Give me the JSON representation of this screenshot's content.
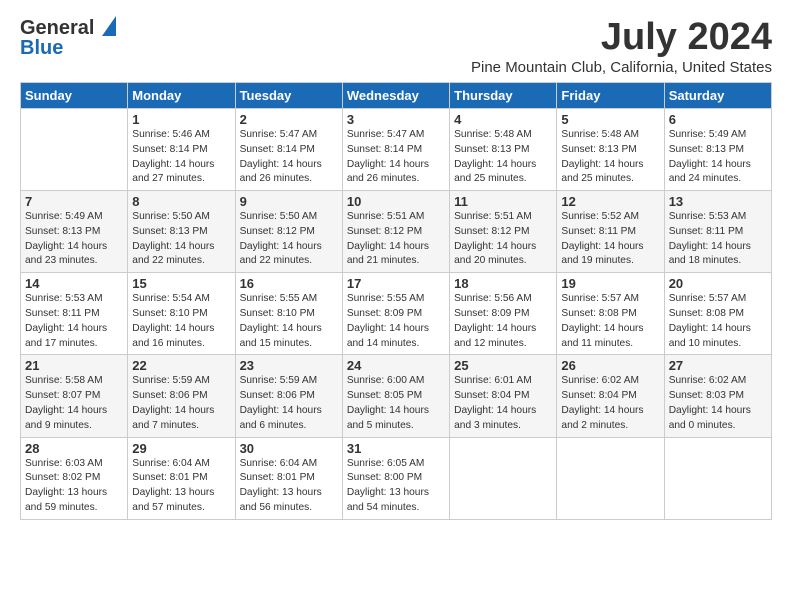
{
  "logo": {
    "general": "General",
    "blue": "Blue"
  },
  "title": "July 2024",
  "subtitle": "Pine Mountain Club, California, United States",
  "days_header": [
    "Sunday",
    "Monday",
    "Tuesday",
    "Wednesday",
    "Thursday",
    "Friday",
    "Saturday"
  ],
  "weeks": [
    [
      {
        "num": "",
        "info": ""
      },
      {
        "num": "1",
        "info": "Sunrise: 5:46 AM\nSunset: 8:14 PM\nDaylight: 14 hours\nand 27 minutes."
      },
      {
        "num": "2",
        "info": "Sunrise: 5:47 AM\nSunset: 8:14 PM\nDaylight: 14 hours\nand 26 minutes."
      },
      {
        "num": "3",
        "info": "Sunrise: 5:47 AM\nSunset: 8:14 PM\nDaylight: 14 hours\nand 26 minutes."
      },
      {
        "num": "4",
        "info": "Sunrise: 5:48 AM\nSunset: 8:13 PM\nDaylight: 14 hours\nand 25 minutes."
      },
      {
        "num": "5",
        "info": "Sunrise: 5:48 AM\nSunset: 8:13 PM\nDaylight: 14 hours\nand 25 minutes."
      },
      {
        "num": "6",
        "info": "Sunrise: 5:49 AM\nSunset: 8:13 PM\nDaylight: 14 hours\nand 24 minutes."
      }
    ],
    [
      {
        "num": "7",
        "info": "Sunrise: 5:49 AM\nSunset: 8:13 PM\nDaylight: 14 hours\nand 23 minutes."
      },
      {
        "num": "8",
        "info": "Sunrise: 5:50 AM\nSunset: 8:13 PM\nDaylight: 14 hours\nand 22 minutes."
      },
      {
        "num": "9",
        "info": "Sunrise: 5:50 AM\nSunset: 8:12 PM\nDaylight: 14 hours\nand 22 minutes."
      },
      {
        "num": "10",
        "info": "Sunrise: 5:51 AM\nSunset: 8:12 PM\nDaylight: 14 hours\nand 21 minutes."
      },
      {
        "num": "11",
        "info": "Sunrise: 5:51 AM\nSunset: 8:12 PM\nDaylight: 14 hours\nand 20 minutes."
      },
      {
        "num": "12",
        "info": "Sunrise: 5:52 AM\nSunset: 8:11 PM\nDaylight: 14 hours\nand 19 minutes."
      },
      {
        "num": "13",
        "info": "Sunrise: 5:53 AM\nSunset: 8:11 PM\nDaylight: 14 hours\nand 18 minutes."
      }
    ],
    [
      {
        "num": "14",
        "info": "Sunrise: 5:53 AM\nSunset: 8:11 PM\nDaylight: 14 hours\nand 17 minutes."
      },
      {
        "num": "15",
        "info": "Sunrise: 5:54 AM\nSunset: 8:10 PM\nDaylight: 14 hours\nand 16 minutes."
      },
      {
        "num": "16",
        "info": "Sunrise: 5:55 AM\nSunset: 8:10 PM\nDaylight: 14 hours\nand 15 minutes."
      },
      {
        "num": "17",
        "info": "Sunrise: 5:55 AM\nSunset: 8:09 PM\nDaylight: 14 hours\nand 14 minutes."
      },
      {
        "num": "18",
        "info": "Sunrise: 5:56 AM\nSunset: 8:09 PM\nDaylight: 14 hours\nand 12 minutes."
      },
      {
        "num": "19",
        "info": "Sunrise: 5:57 AM\nSunset: 8:08 PM\nDaylight: 14 hours\nand 11 minutes."
      },
      {
        "num": "20",
        "info": "Sunrise: 5:57 AM\nSunset: 8:08 PM\nDaylight: 14 hours\nand 10 minutes."
      }
    ],
    [
      {
        "num": "21",
        "info": "Sunrise: 5:58 AM\nSunset: 8:07 PM\nDaylight: 14 hours\nand 9 minutes."
      },
      {
        "num": "22",
        "info": "Sunrise: 5:59 AM\nSunset: 8:06 PM\nDaylight: 14 hours\nand 7 minutes."
      },
      {
        "num": "23",
        "info": "Sunrise: 5:59 AM\nSunset: 8:06 PM\nDaylight: 14 hours\nand 6 minutes."
      },
      {
        "num": "24",
        "info": "Sunrise: 6:00 AM\nSunset: 8:05 PM\nDaylight: 14 hours\nand 5 minutes."
      },
      {
        "num": "25",
        "info": "Sunrise: 6:01 AM\nSunset: 8:04 PM\nDaylight: 14 hours\nand 3 minutes."
      },
      {
        "num": "26",
        "info": "Sunrise: 6:02 AM\nSunset: 8:04 PM\nDaylight: 14 hours\nand 2 minutes."
      },
      {
        "num": "27",
        "info": "Sunrise: 6:02 AM\nSunset: 8:03 PM\nDaylight: 14 hours\nand 0 minutes."
      }
    ],
    [
      {
        "num": "28",
        "info": "Sunrise: 6:03 AM\nSunset: 8:02 PM\nDaylight: 13 hours\nand 59 minutes."
      },
      {
        "num": "29",
        "info": "Sunrise: 6:04 AM\nSunset: 8:01 PM\nDaylight: 13 hours\nand 57 minutes."
      },
      {
        "num": "30",
        "info": "Sunrise: 6:04 AM\nSunset: 8:01 PM\nDaylight: 13 hours\nand 56 minutes."
      },
      {
        "num": "31",
        "info": "Sunrise: 6:05 AM\nSunset: 8:00 PM\nDaylight: 13 hours\nand 54 minutes."
      },
      {
        "num": "",
        "info": ""
      },
      {
        "num": "",
        "info": ""
      },
      {
        "num": "",
        "info": ""
      }
    ]
  ]
}
